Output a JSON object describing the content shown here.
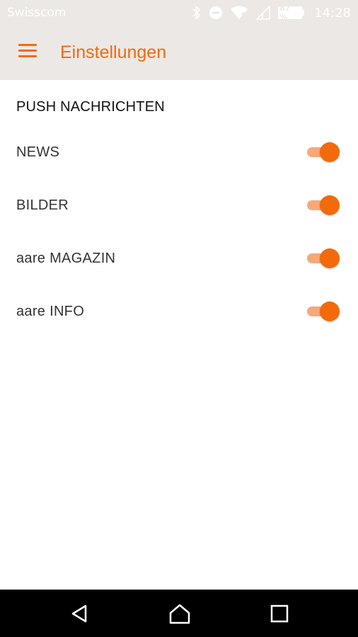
{
  "status_bar": {
    "carrier": "Swisscom",
    "battery_level": "87 %",
    "time": "14:28",
    "icons": [
      "bluetooth-icon",
      "do-not-disturb-icon",
      "wifi-icon",
      "signal-icon",
      "battery-icon"
    ]
  },
  "app_bar": {
    "menu_icon": "hamburger-menu-icon",
    "title": "Einstellungen"
  },
  "settings": {
    "section_title": "PUSH NACHRICHTEN",
    "items": [
      {
        "label": "NEWS",
        "enabled": true
      },
      {
        "label": "BILDER",
        "enabled": true
      },
      {
        "label": "aare MAGAZIN",
        "enabled": true
      },
      {
        "label": "aare INFO",
        "enabled": true
      }
    ]
  },
  "nav_bar": {
    "buttons": [
      "back-icon",
      "home-icon",
      "recents-icon"
    ]
  },
  "colors": {
    "accent": "#f26a0c",
    "accent_light": "#f7a87a",
    "app_bar_bg": "#ebe8e5",
    "nav_bg": "#000000"
  }
}
